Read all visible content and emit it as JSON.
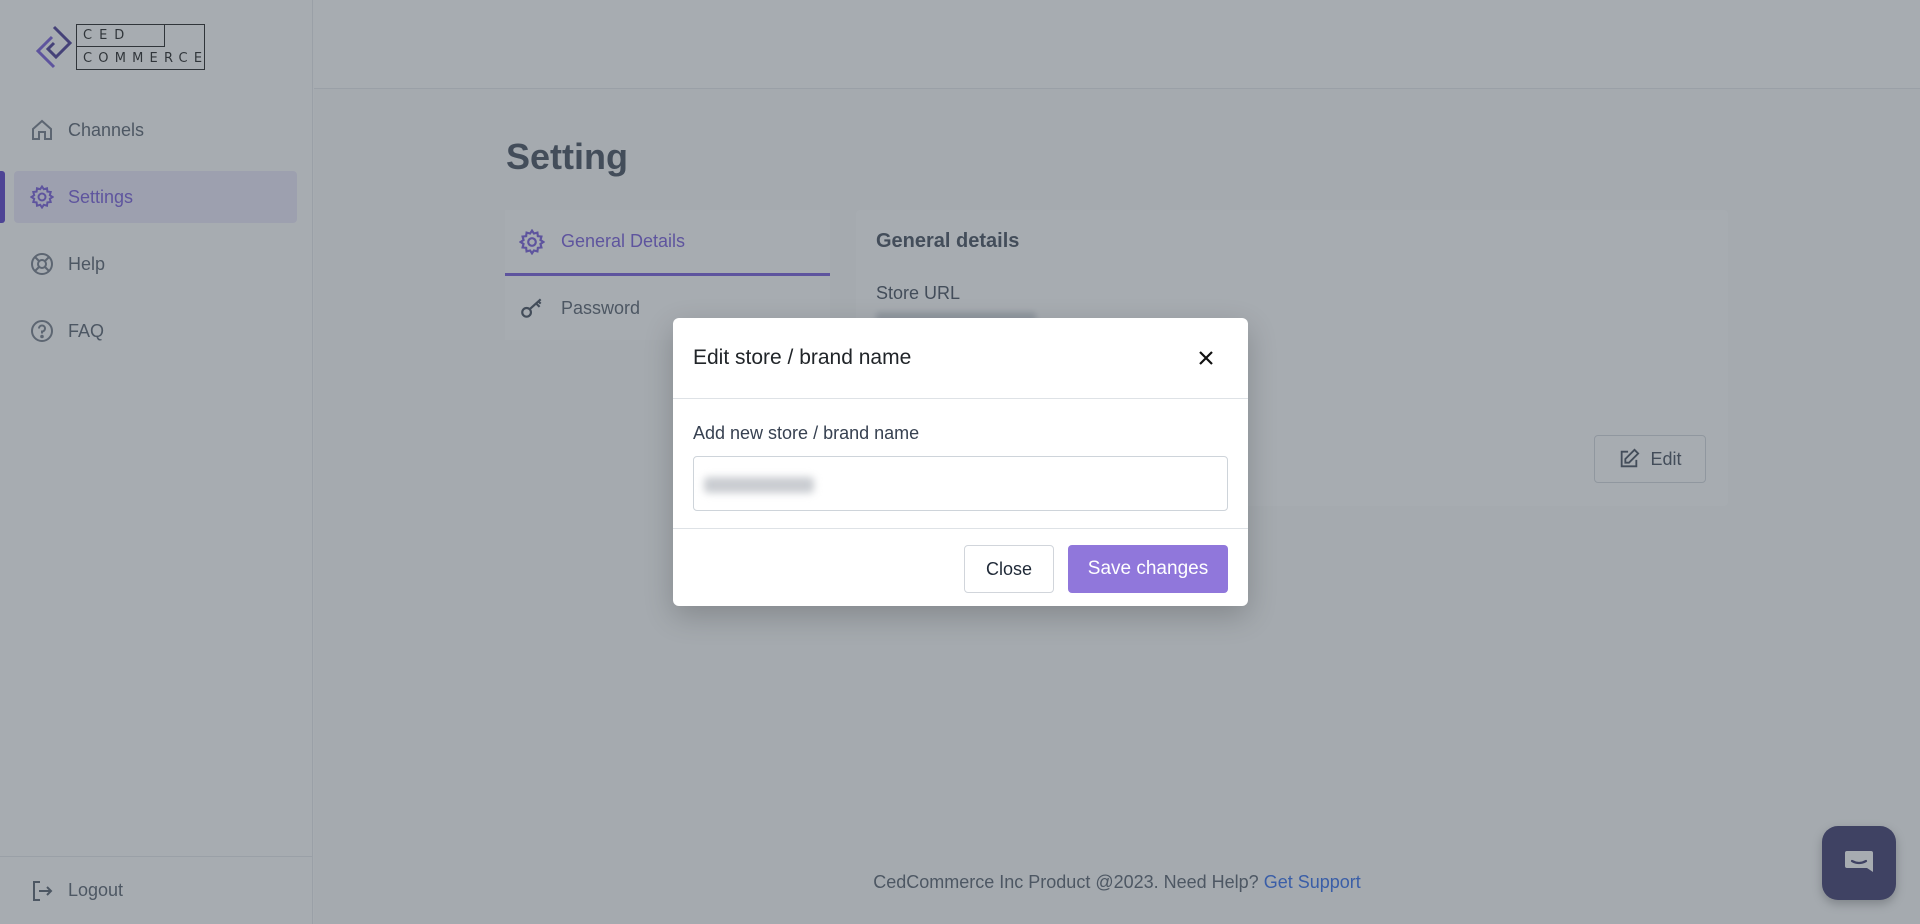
{
  "brand": {
    "logo_top": "CED",
    "logo_bottom": "COMMERCE"
  },
  "sidebar": {
    "items": [
      {
        "label": "Channels",
        "icon": "home-icon"
      },
      {
        "label": "Settings",
        "icon": "gear-icon",
        "active": true
      },
      {
        "label": "Help",
        "icon": "lifebuoy-icon"
      },
      {
        "label": "FAQ",
        "icon": "question-circle-icon"
      }
    ],
    "logout_label": "Logout"
  },
  "page": {
    "title": "Setting",
    "tabs": [
      {
        "label": "General Details",
        "icon": "gear-icon",
        "active": true
      },
      {
        "label": "Password",
        "icon": "key-icon"
      }
    ],
    "card": {
      "title": "General details",
      "store_url_label": "Store URL",
      "edit_label": "Edit"
    }
  },
  "footer": {
    "text": "CedCommerce Inc Product @2023. Need Help? ",
    "link": "Get Support"
  },
  "modal": {
    "title": "Edit store / brand name",
    "field_label": "Add new store / brand name",
    "close_label": "Close",
    "save_label": "Save changes"
  },
  "colors": {
    "accent": "#6d4fd8",
    "save_button": "#9077db",
    "chat": "#2e2a63",
    "link": "#2563eb"
  }
}
